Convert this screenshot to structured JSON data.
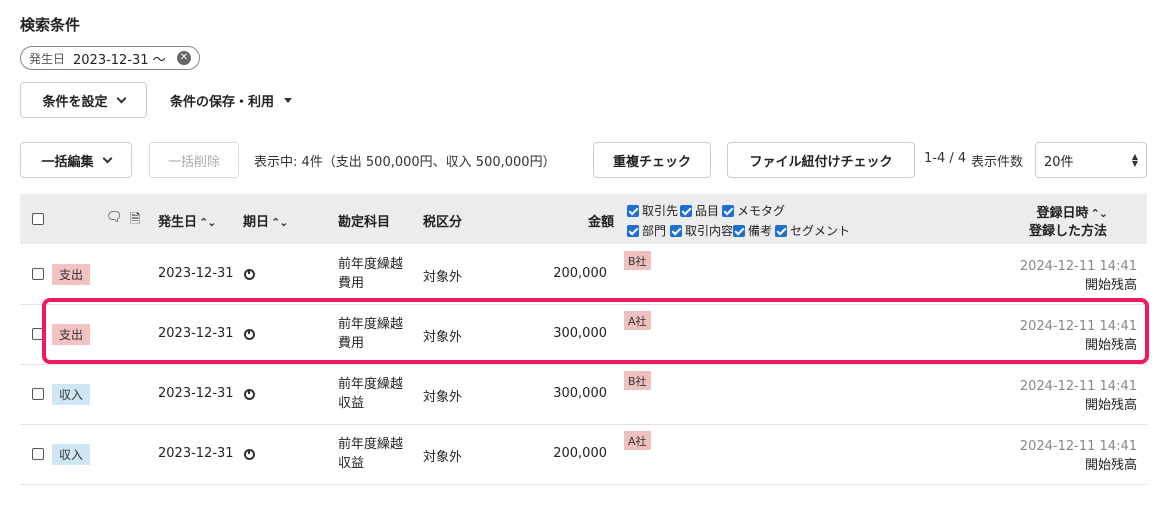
{
  "search": {
    "title": "検索条件",
    "chip_key": "発生日",
    "chip_value": "2023-12-31 〜",
    "set_condition_label": "条件を設定",
    "save_use_label": "条件の保存・利用"
  },
  "toolbar": {
    "bulk_edit_label": "一括編集",
    "bulk_delete_label": "一括削除",
    "summary": "表示中: 4件（支出 500,000円、収入 500,000円）",
    "duplicate_check_label": "重複チェック",
    "file_link_check_label": "ファイル紐付けチェック",
    "page_range": "1-4 / 4",
    "per_page_label": "表示件数",
    "per_page_value": "20件"
  },
  "table": {
    "headers": {
      "date": "発生日",
      "due": "期日",
      "account": "勘定科目",
      "tax": "税区分",
      "amount": "金額",
      "registered_at": "登録日時",
      "registered_method": "登録した方法"
    },
    "column_options": [
      {
        "label": "取引先",
        "checked": true
      },
      {
        "label": "品目",
        "checked": true
      },
      {
        "label": "メモタグ",
        "checked": true
      },
      {
        "label": "部門",
        "checked": true
      },
      {
        "label": "取引内容",
        "checked": true
      },
      {
        "label": "備考",
        "checked": true
      },
      {
        "label": "セグメント",
        "checked": true
      }
    ],
    "rows": [
      {
        "type": "支出",
        "kind": "expense",
        "date": "2023-12-31",
        "account_line1": "前年度繰越",
        "account_line2": "費用",
        "tax": "対象外",
        "amount": "200,000",
        "partner": "B社",
        "registered_at": "2024-12-11 14:41",
        "method": "開始残高"
      },
      {
        "type": "支出",
        "kind": "expense",
        "date": "2023-12-31",
        "account_line1": "前年度繰越",
        "account_line2": "費用",
        "tax": "対象外",
        "amount": "300,000",
        "partner": "A社",
        "registered_at": "2024-12-11 14:41",
        "method": "開始残高"
      },
      {
        "type": "収入",
        "kind": "income",
        "date": "2023-12-31",
        "account_line1": "前年度繰越",
        "account_line2": "収益",
        "tax": "対象外",
        "amount": "300,000",
        "partner": "B社",
        "registered_at": "2024-12-11 14:41",
        "method": "開始残高"
      },
      {
        "type": "収入",
        "kind": "income",
        "date": "2023-12-31",
        "account_line1": "前年度繰越",
        "account_line2": "収益",
        "tax": "対象外",
        "amount": "200,000",
        "partner": "A社",
        "registered_at": "2024-12-11 14:41",
        "method": "開始残高"
      }
    ]
  },
  "colors": {
    "expense_badge": "#f3c2c2",
    "income_badge": "#cfe6f5",
    "highlight": "#f0195d",
    "checkbox_checked": "#1f6fd1"
  }
}
